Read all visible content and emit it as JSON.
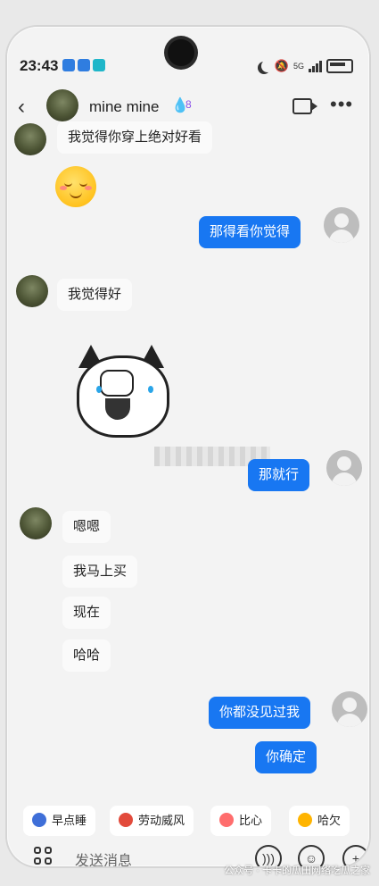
{
  "status_bar": {
    "time": "23:43",
    "network": "5G"
  },
  "header": {
    "contact_name": "mine  mine",
    "level": "8"
  },
  "messages": [
    {
      "side": "left",
      "type": "text",
      "text": "我觉得你穿上绝对好看"
    },
    {
      "side": "left",
      "type": "emoji",
      "emoji": "smiling-face-icon"
    },
    {
      "side": "right",
      "type": "text",
      "text": "那得看你觉得"
    },
    {
      "side": "left",
      "type": "text",
      "text": "我觉得好"
    },
    {
      "side": "left",
      "type": "sticker",
      "emoji": "cat-laughing-sticker"
    },
    {
      "side": "right",
      "type": "text",
      "text": "那就行"
    },
    {
      "side": "left",
      "type": "text",
      "text": "嗯嗯"
    },
    {
      "side": "left",
      "type": "text",
      "text": "我马上买"
    },
    {
      "side": "left",
      "type": "text",
      "text": "现在"
    },
    {
      "side": "left",
      "type": "text",
      "text": "哈哈"
    },
    {
      "side": "right",
      "type": "text",
      "text": "你都没见过我"
    },
    {
      "side": "right",
      "type": "text",
      "text": "你确定"
    }
  ],
  "quick_replies": [
    {
      "label": "早点睡",
      "icon": "moon-icon"
    },
    {
      "label": "劳动威风",
      "icon": "drum-icon"
    },
    {
      "label": "比心",
      "icon": "heart-hand-icon"
    },
    {
      "label": "哈欠",
      "icon": "yawn-icon"
    }
  ],
  "input": {
    "placeholder": "发送消息"
  },
  "watermark": "公众号 · 卡卡的瓜田网络吃瓜之家",
  "colors": {
    "accent": "#1877f2",
    "bubble_left": "#fafafa",
    "background": "#f3f3f3"
  }
}
